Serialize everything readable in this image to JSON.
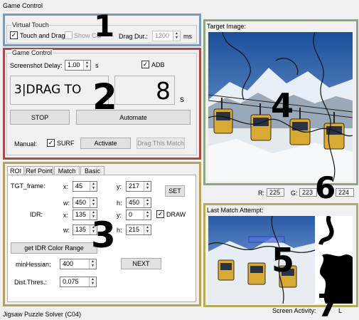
{
  "window": {
    "title": "Game Control"
  },
  "annotations": {
    "n1": "1",
    "n2": "2",
    "n3": "3",
    "n4": "4",
    "n5": "5",
    "n6": "6",
    "n7": "7"
  },
  "colors": {
    "box1": "#7f9ab5",
    "box2": "#a94a48",
    "box3": "#b7a25b",
    "box4": "#8ea77e",
    "box5": "#b2ae55"
  },
  "virtual_touch": {
    "title": "Virtual Touch",
    "touch_and_drag_label": "Touch and Drag",
    "touch_and_drag_checked": "✓",
    "show_cursor_label": "Show Cur",
    "drag_dur_label": "Drag Dur.:",
    "drag_dur_value": "1200",
    "drag_dur_unit": "ms"
  },
  "game_control": {
    "title": "Game Control",
    "screenshot_delay_label": "Screenshot Delay:",
    "screenshot_delay_value": "1.00",
    "screenshot_delay_unit": "s",
    "adb_label": "ADB",
    "adb_checked": "✓",
    "step_display": "3|DRAG TO",
    "counter_display": "8",
    "counter_unit": "s",
    "stop_label": "STOP",
    "automate_label": "Automate",
    "manual_label": "Manual:",
    "surf_label": "SURF",
    "surf_checked": "✓",
    "activate_label": "Activate",
    "drag_match_label": "Drag This Match"
  },
  "roi_panel": {
    "tabs": [
      "ROI",
      "Ref Point",
      "Match",
      "Basic"
    ],
    "tgt_frame_label": "TGT_frame:",
    "x_label": "x:",
    "y_label": "y:",
    "w_label": "w:",
    "h_label": "h:",
    "tgt_x": "45",
    "tgt_y": "217",
    "tgt_w": "450",
    "tgt_h": "450",
    "set_label": "SET",
    "idr_label": "IDR:",
    "idr_x": "135",
    "idr_y": "0",
    "idr_w": "135",
    "idr_h": "215",
    "draw_label": "DRAW",
    "draw_checked": "✓",
    "get_color_label": "get IDR Color Range",
    "min_hessian_label": "minHessian:",
    "min_hessian_value": "400",
    "next_label": "NEXT",
    "dist_thres_label": "Dist.Thres.:",
    "dist_thres_value": "0.075"
  },
  "target_image": {
    "title": "Target Image:",
    "r_label": "R:",
    "r_value": "225",
    "g_label": "G:",
    "g_value": "223",
    "b_value": "224"
  },
  "last_match": {
    "title": "Last Match Attempt:"
  },
  "status_bar": {
    "app_name": "Jigsaw Puzzle Solver  (C04)",
    "screen_activity_label": "Screen Activity:",
    "screen_activity_value": "L"
  }
}
